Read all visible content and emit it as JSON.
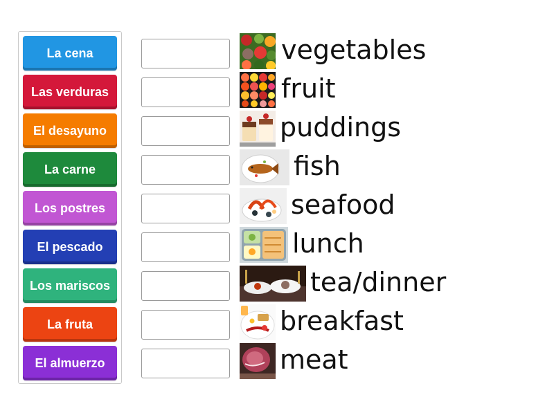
{
  "tiles": [
    {
      "label": "La cena",
      "color": "#2196e3"
    },
    {
      "label": "Las verduras",
      "color": "#d4183a"
    },
    {
      "label": "El desayuno",
      "color": "#f57c00"
    },
    {
      "label": "La carne",
      "color": "#1e8a3c"
    },
    {
      "label": "Los postres",
      "color": "#c156d3"
    },
    {
      "label": "El pescado",
      "color": "#233fb4"
    },
    {
      "label": "Los mariscos",
      "color": "#2fb37d"
    },
    {
      "label": "La fruta",
      "color": "#ec4412"
    },
    {
      "label": "El almuerzo",
      "color": "#8b2fd6"
    }
  ],
  "targets": [
    {
      "word": "vegetables",
      "image": "vegetables-photo"
    },
    {
      "word": "fruit",
      "image": "fruit-photo"
    },
    {
      "word": "puddings",
      "image": "puddings-photo"
    },
    {
      "word": "fish",
      "image": "fish-photo"
    },
    {
      "word": "seafood",
      "image": "seafood-photo"
    },
    {
      "word": "lunch",
      "image": "lunch-photo"
    },
    {
      "word": "tea/dinner",
      "image": "dinner-photo"
    },
    {
      "word": "breakfast",
      "image": "breakfast-photo"
    },
    {
      "word": "meat",
      "image": "meat-photo"
    }
  ]
}
